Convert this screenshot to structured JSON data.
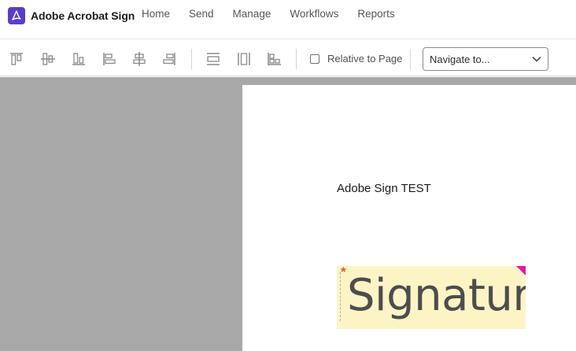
{
  "app": {
    "name": "Adobe Acrobat Sign",
    "logo_icon": "acrobat-logo-icon",
    "brand_color": "#5a3ec8"
  },
  "nav": {
    "items": [
      {
        "label": "Home"
      },
      {
        "label": "Send"
      },
      {
        "label": "Manage"
      },
      {
        "label": "Workflows"
      },
      {
        "label": "Reports"
      }
    ]
  },
  "toolbar": {
    "align_buttons": [
      {
        "icon": "align-top-icon"
      },
      {
        "icon": "align-middle-icon"
      },
      {
        "icon": "align-bottom-icon"
      },
      {
        "icon": "align-left-icon"
      },
      {
        "icon": "align-center-icon"
      },
      {
        "icon": "align-right-icon"
      }
    ],
    "distribute_buttons": [
      {
        "icon": "distribute-vertical-icon"
      },
      {
        "icon": "distribute-horizontal-icon"
      },
      {
        "icon": "match-size-icon"
      }
    ],
    "relative_to_page": {
      "label": "Relative to Page",
      "checked": false
    },
    "navigate": {
      "value": "Navigate to..."
    }
  },
  "document": {
    "text": "Adobe Sign TEST",
    "signature_field": {
      "placeholder": "Signature",
      "required_marker": "*",
      "required_color": "#e8582b",
      "corner_color": "#e01aa5",
      "background": "#fdf4c6"
    }
  }
}
